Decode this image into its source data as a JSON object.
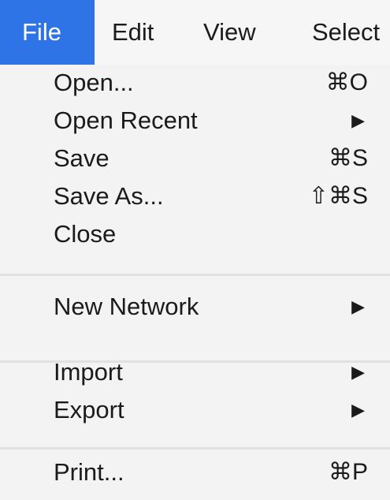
{
  "menubar": {
    "items": [
      {
        "label": "File",
        "active": true
      },
      {
        "label": "Edit",
        "active": false
      },
      {
        "label": "View",
        "active": false
      },
      {
        "label": "Select",
        "active": false
      }
    ]
  },
  "file_menu": {
    "groups": [
      [
        {
          "label": "Open...",
          "shortcut": "⌘O"
        },
        {
          "label": "Open Recent",
          "submenu_icon": "▶"
        },
        {
          "label": "Save",
          "shortcut": "⌘S"
        },
        {
          "label": "Save As...",
          "shortcut": "⇧⌘S"
        },
        {
          "label": "Close"
        }
      ],
      [
        {
          "label": "New Network",
          "submenu_icon": "▶"
        }
      ],
      [
        {
          "label": "Import",
          "submenu_icon": "▶"
        },
        {
          "label": "Export",
          "submenu_icon": "▶"
        }
      ],
      [
        {
          "label": "Print...",
          "shortcut": "⌘P"
        }
      ]
    ]
  },
  "colors": {
    "active_menu_bg": "#2f74e6",
    "menu_bg": "#f3f3f3",
    "separator": "#e1e1e1"
  }
}
